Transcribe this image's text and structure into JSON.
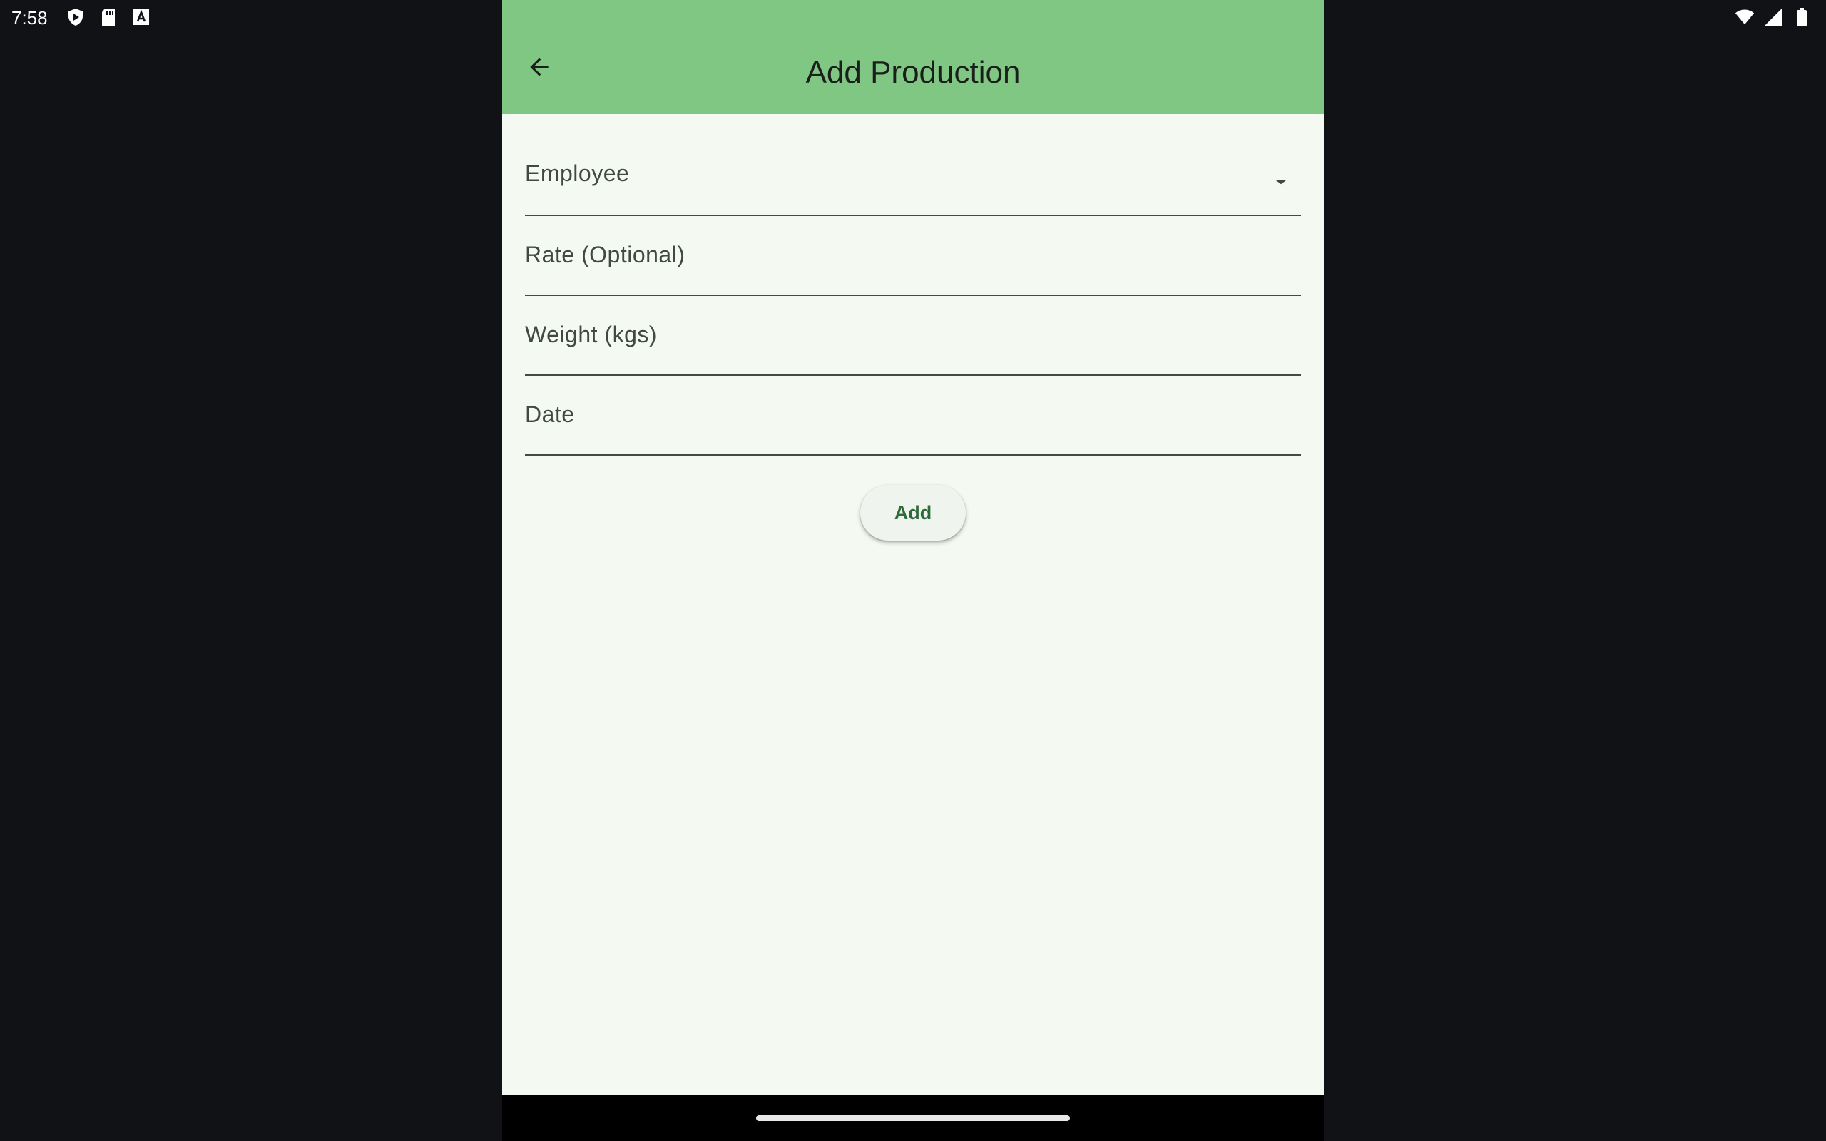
{
  "status_bar": {
    "time": "7:58",
    "left_icons": [
      "play-protect-icon",
      "sd-card-icon",
      "text-a-icon"
    ],
    "right_icons": [
      "wifi-icon",
      "cellular-signal-icon",
      "battery-icon"
    ]
  },
  "app_bar": {
    "title": "Add Production",
    "back_icon": "arrow-back-icon",
    "color": "#81c784"
  },
  "form": {
    "employee_label": "Employee",
    "rate_label": "Rate (Optional)",
    "weight_label": "Weight (kgs)",
    "date_label": "Date",
    "dropdown_icon": "arrow-drop-down-icon"
  },
  "actions": {
    "add_label": "Add"
  },
  "colors": {
    "background": "#f4faf2",
    "accent_text": "#2e6b3a"
  }
}
